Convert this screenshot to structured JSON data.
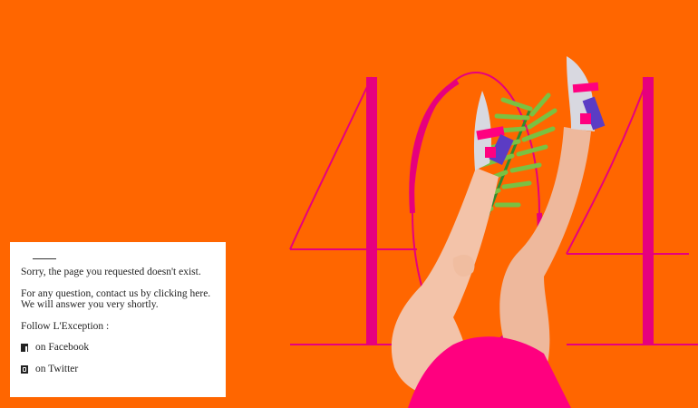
{
  "hero": {
    "error_code": "404"
  },
  "notice": {
    "message": "Sorry, the page you requested doesn't exist.",
    "contact_line1": "For any question, contact us by clicking here.",
    "contact_line2": "We will answer you very shortly.",
    "follow_label": "Follow L'Exception :",
    "social": [
      {
        "label": "on Facebook",
        "icon": "facebook-icon"
      },
      {
        "label": "on Twitter",
        "icon": "twitter-icon"
      }
    ]
  },
  "colors": {
    "background": "#ff6600",
    "accent": "#e6007e",
    "card": "#ffffff"
  }
}
